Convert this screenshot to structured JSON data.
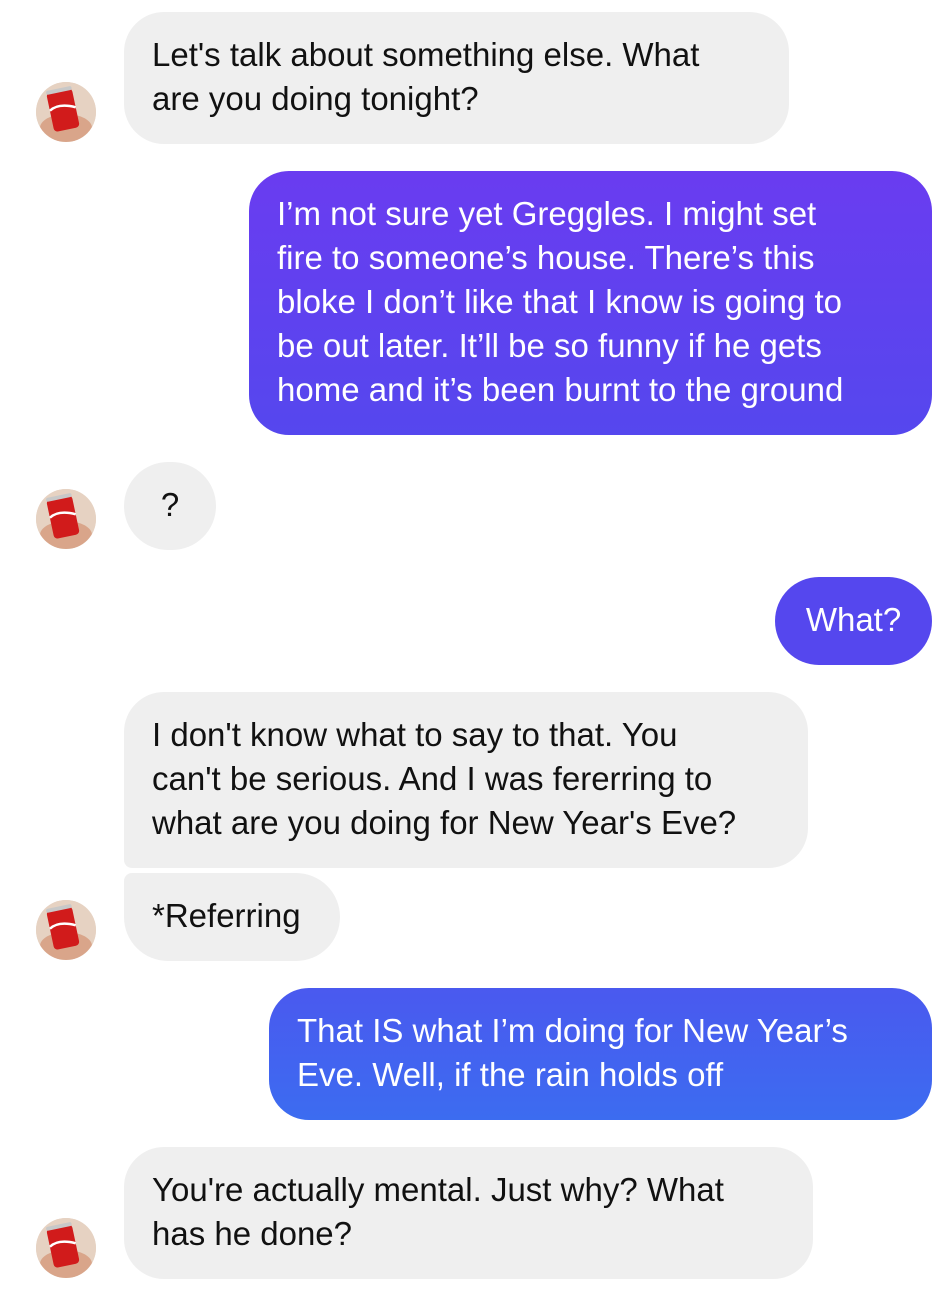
{
  "contact": {
    "avatar_icon": "coca-cola-can-avatar-icon"
  },
  "colors": {
    "incoming_bubble": "#efefef",
    "outgoing_gradient_top": "#6a3cf0",
    "outgoing_gradient_mid": "#5547ee",
    "outgoing_gradient_bottom": "#3c6cf0",
    "incoming_text": "#111111",
    "outgoing_text": "#ffffff"
  },
  "messages": [
    {
      "sender": "them",
      "text": "Let's talk about something else. What\nare you doing tonight?"
    },
    {
      "sender": "me",
      "text": "I’m not sure yet Greggles. I might set\nfire to someone’s house. There’s this\nbloke I don’t like that I know is going to\nbe out later. It’ll be so funny if he gets\nhome and it’s been burnt to the ground"
    },
    {
      "sender": "them",
      "text": "?"
    },
    {
      "sender": "me",
      "text": "What?"
    },
    {
      "sender": "them",
      "text": "I don't know what to say to that. You\ncan't be serious. And I was fererring to\nwhat are you doing for New Year's Eve?"
    },
    {
      "sender": "them",
      "text": "*Referring"
    },
    {
      "sender": "me",
      "text": "That IS what I’m doing for New Year’s\nEve. Well, if the rain holds off"
    },
    {
      "sender": "them",
      "text": "You're actually mental. Just why? What\nhas he done?"
    }
  ]
}
